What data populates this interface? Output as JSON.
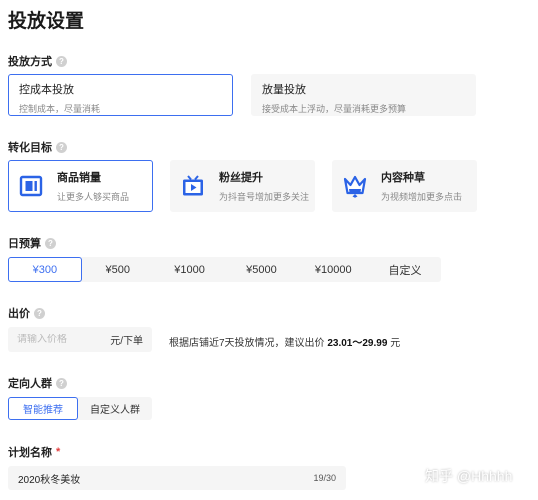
{
  "page": {
    "title": "投放设置"
  },
  "placement": {
    "label": "投放方式",
    "options": [
      {
        "title": "控成本投放",
        "subtitle": "控制成本，尽量消耗",
        "selected": true
      },
      {
        "title": "放量投放",
        "subtitle": "接受成本上浮动，尽量消耗更多预算",
        "selected": false
      }
    ]
  },
  "goal": {
    "label": "转化目标",
    "options": [
      {
        "title": "商品销量",
        "subtitle": "让更多人够买商品",
        "icon": "goods-icon",
        "selected": true
      },
      {
        "title": "粉丝提升",
        "subtitle": "为抖音号增加更多关注",
        "icon": "tv-icon",
        "selected": false
      },
      {
        "title": "内容种草",
        "subtitle": "为视频增加更多点击",
        "icon": "crown-icon",
        "selected": false
      }
    ]
  },
  "budget": {
    "label": "日预算",
    "options": [
      "¥300",
      "¥500",
      "¥1000",
      "¥5000",
      "¥10000",
      "自定义"
    ],
    "selected": "¥300"
  },
  "bid": {
    "label": "出价",
    "placeholder": "请输入价格",
    "unit": "元/下单",
    "hint_prefix": "根据店铺近7天投放情况，建议出价",
    "hint_range": "23.01〜29.99",
    "hint_suffix": "元"
  },
  "audience": {
    "label": "定向人群",
    "options": [
      "智能推荐",
      "自定义人群"
    ],
    "selected": "智能推荐"
  },
  "plan_name": {
    "label": "计划名称",
    "required_mark": "*",
    "value": "2020秋冬美妆",
    "count": "19/30"
  },
  "watermark": {
    "text": "知乎 @Hhhhh"
  },
  "colors": {
    "accent": "#3d6ff0",
    "card_bg": "#f6f6f6",
    "goal_icon_blue": "#2b63e6"
  }
}
